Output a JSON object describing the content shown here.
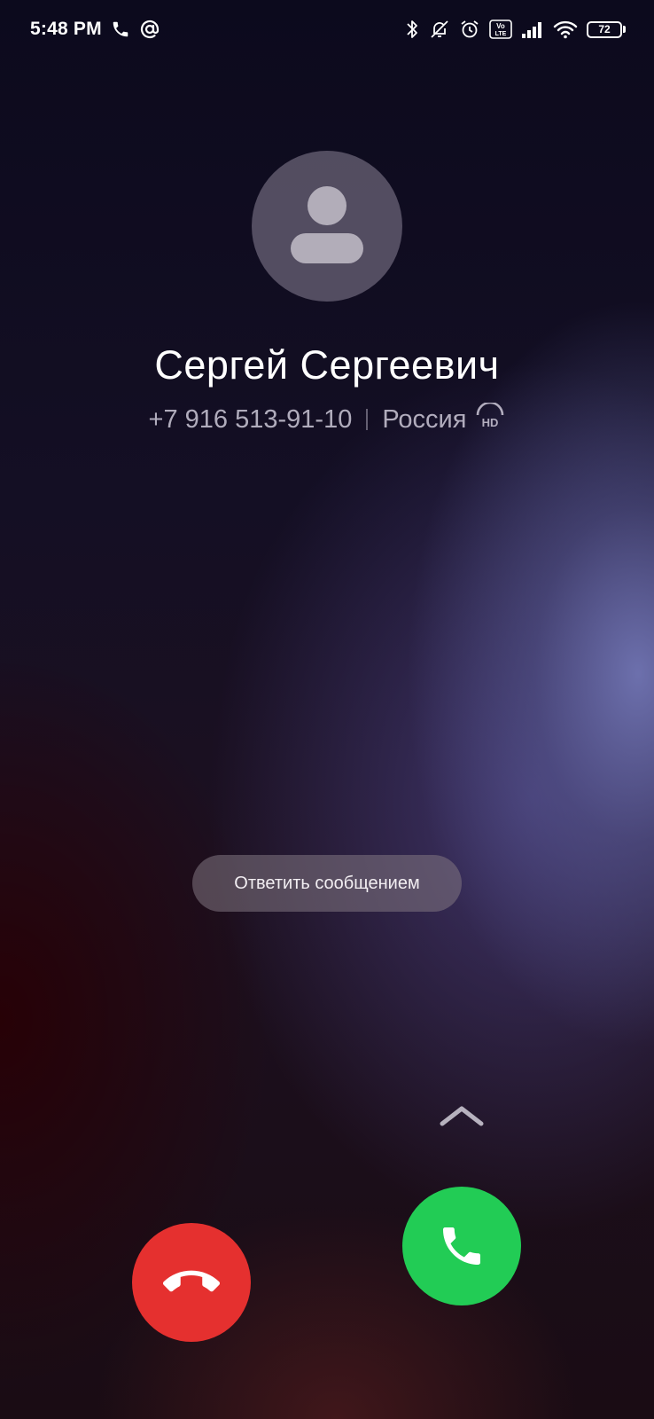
{
  "status_bar": {
    "time": "5:48 PM",
    "left_icons": [
      "phone-icon",
      "at-sign-icon"
    ],
    "right_icons": [
      "bluetooth-icon",
      "bell-muted-icon",
      "alarm-icon",
      "volte-icon",
      "signal-icon",
      "wifi-icon",
      "battery-icon"
    ],
    "volte_label": "Vo LTE",
    "battery_level": "72"
  },
  "caller": {
    "name": "Сергей Сергеевич",
    "number": "+7 916 513-91-10",
    "region": "Россия",
    "hd_label": "HD"
  },
  "actions": {
    "reply_message_label": "Ответить сообщением"
  },
  "colors": {
    "decline": "#e5302f",
    "answer": "#22cc55"
  }
}
